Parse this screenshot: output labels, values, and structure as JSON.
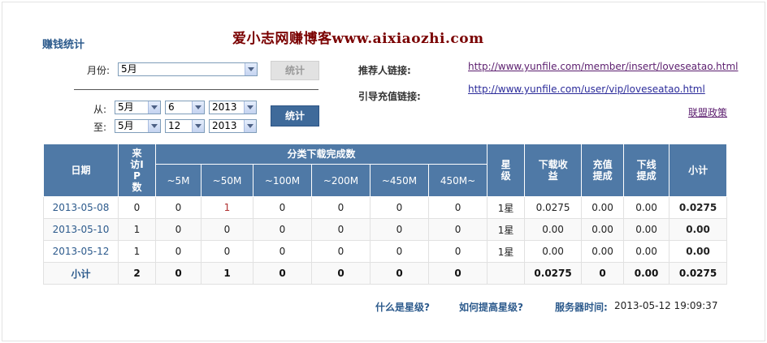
{
  "header": {
    "section_title": "赚钱统计",
    "watermark": "爱小志网赚博客www.aixiaozhi.com"
  },
  "filters": {
    "month_label": "月份:",
    "month_value": "5月",
    "stat_button_disabled": "统计",
    "from_label": "从:",
    "to_label": "至:",
    "from": {
      "month": "5月",
      "day": "6",
      "year": "2013"
    },
    "to": {
      "month": "5月",
      "day": "12",
      "year": "2013"
    },
    "stat_button": "统计"
  },
  "links": {
    "referrer_label": "推荐人链接:",
    "referrer_url": "http://www.yunfile.com/member/insert/loveseatao.html",
    "recharge_label": "引导充值链接:",
    "recharge_url": "http://www.yunfile.com/user/vip/loveseatao.html",
    "policy": "联盟政策"
  },
  "table": {
    "headers": {
      "date": "日期",
      "visits": "来访IP数",
      "category_group": "分类下载完成数",
      "categories": [
        "~5M",
        "~50M",
        "~100M",
        "~200M",
        "~450M",
        "450M~"
      ],
      "star": "星级",
      "download_income": "下载收益",
      "recharge_income": "充值提成",
      "downline_income": "下线提成",
      "subtotal": "小计"
    },
    "rows": [
      {
        "date": "2013-05-08",
        "visits": "0",
        "c1": "0",
        "c2": "1",
        "c3": "0",
        "c4": "0",
        "c5": "0",
        "c6": "0",
        "star": "1星",
        "download": "0.0275",
        "recharge": "0.00",
        "downline": "0.00",
        "subtotal": "0.0275"
      },
      {
        "date": "2013-05-10",
        "visits": "1",
        "c1": "0",
        "c2": "0",
        "c3": "0",
        "c4": "0",
        "c5": "0",
        "c6": "0",
        "star": "1星",
        "download": "0.00",
        "recharge": "0.00",
        "downline": "0.00",
        "subtotal": "0.00"
      },
      {
        "date": "2013-05-12",
        "visits": "1",
        "c1": "0",
        "c2": "0",
        "c3": "0",
        "c4": "0",
        "c5": "0",
        "c6": "0",
        "star": "1星",
        "download": "0.00",
        "recharge": "0.00",
        "downline": "0.00",
        "subtotal": "0.00"
      }
    ],
    "total": {
      "label": "小计",
      "visits": "2",
      "c1": "0",
      "c2": "1",
      "c3": "0",
      "c4": "0",
      "c5": "0",
      "c6": "0",
      "star": "",
      "download": "0.0275",
      "recharge": "0",
      "downline": "0.00",
      "subtotal": "0.0275"
    }
  },
  "footer": {
    "what_is_star": "什么是星级?",
    "improve_star": "如何提高星级?",
    "server_time_label": "服务器时间:",
    "server_time": "2013-05-12 19:09:37"
  }
}
